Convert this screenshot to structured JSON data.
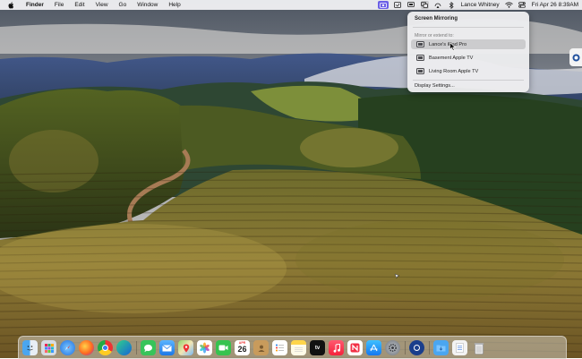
{
  "menubar": {
    "app_name": "Finder",
    "menus": [
      "File",
      "Edit",
      "View",
      "Go",
      "Window",
      "Help"
    ],
    "user_name": "Lance Whitney",
    "clock": "Fri Apr 26  8:39AM",
    "icons": [
      "apple-logo",
      "screen-mirroring",
      "screen-record",
      "display",
      "control-center",
      "bluetooth",
      "wifi",
      "siri"
    ]
  },
  "screen_mirroring": {
    "title": "Screen Mirroring",
    "subtitle": "Mirror or extend to:",
    "devices": [
      {
        "label": "Lance's iPad Pro",
        "selected": true
      },
      {
        "label": "Basement Apple TV",
        "selected": false
      },
      {
        "label": "Living Room Apple TV",
        "selected": false
      }
    ],
    "settings_label": "Display Settings..."
  },
  "dock": {
    "calendar_month": "APR",
    "calendar_day": "26",
    "apps": [
      "Finder",
      "Launchpad",
      "Safari",
      "Firefox",
      "Chrome",
      "Edge",
      "Messages",
      "Mail",
      "Maps",
      "Photos",
      "FaceTime",
      "Calendar",
      "Contacts",
      "Reminders",
      "Notes",
      "Apple TV",
      "Music",
      "News",
      "App Store",
      "System Settings",
      "1Password",
      "Downloads",
      "Documents",
      "Trash"
    ]
  },
  "colors": {
    "accent": "#6a5fe6",
    "menubar_bg": "#f4f4f6",
    "popover_bg": "#ececee"
  }
}
